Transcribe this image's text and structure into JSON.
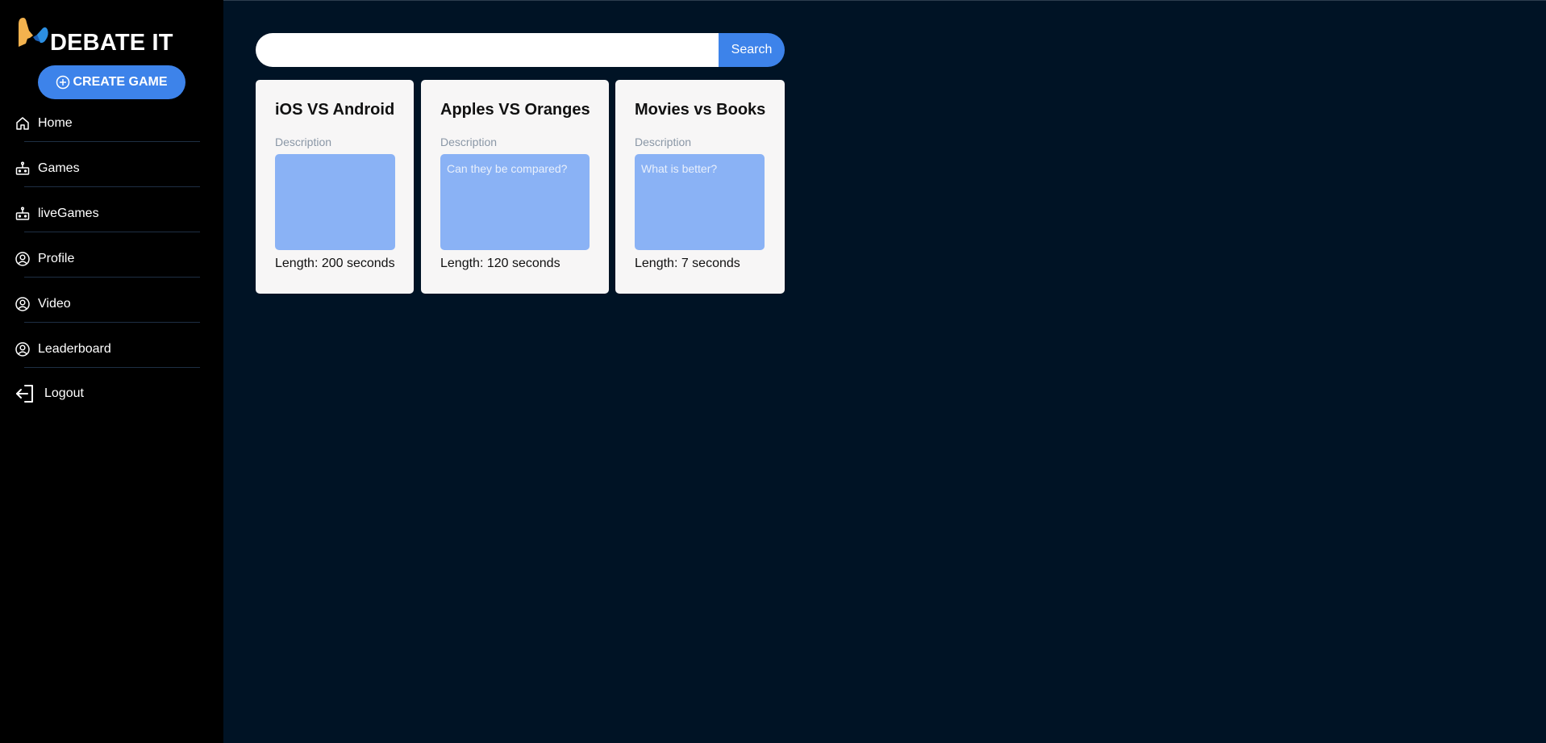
{
  "app": {
    "logo_text": "DEBATE IT"
  },
  "sidebar": {
    "create_button": "CREATE GAME",
    "items": [
      {
        "label": "Home",
        "icon": "home-icon"
      },
      {
        "label": "Games",
        "icon": "robot-icon"
      },
      {
        "label": "liveGames",
        "icon": "robot-icon"
      },
      {
        "label": "Profile",
        "icon": "user-circle-icon"
      },
      {
        "label": "Video",
        "icon": "user-circle-icon"
      },
      {
        "label": "Leaderboard",
        "icon": "user-circle-icon"
      }
    ],
    "logout": {
      "label": "Logout",
      "icon": "logout-icon"
    }
  },
  "search": {
    "value": "",
    "placeholder": "",
    "button_label": "Search"
  },
  "games": [
    {
      "title": "iOS VS Android",
      "description_label": "Description",
      "description": "",
      "length": "Length: 200 seconds"
    },
    {
      "title": "Apples VS Oranges",
      "description_label": "Description",
      "description": "Can they be compared?",
      "length": "Length: 120 seconds"
    },
    {
      "title": "Movies vs Books",
      "description_label": "Description",
      "description": "What is better?",
      "length": "Length: 7 seconds"
    }
  ],
  "colors": {
    "background": "#001325",
    "sidebar": "#000000",
    "accent": "#3d83ea",
    "card": "#f7f6f6",
    "description_box": "#8ab2f5"
  }
}
